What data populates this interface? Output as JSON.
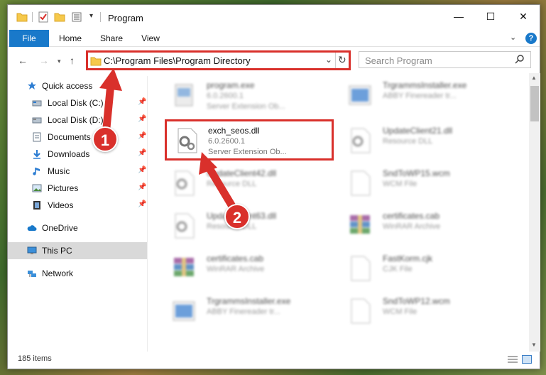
{
  "window": {
    "title": "Program",
    "controls": {
      "minimize": "—",
      "maximize": "☐",
      "close": "✕"
    }
  },
  "ribbon": {
    "tabs": [
      "File",
      "Home",
      "Share",
      "View"
    ],
    "collapse_icon": "chevron-down-icon",
    "help_label": "?"
  },
  "address_bar": {
    "path": "C:\\Program Files\\Program Directory",
    "refresh_icon": "refresh-icon"
  },
  "search": {
    "placeholder": "Search Program"
  },
  "sidebar": {
    "items": [
      {
        "label": "Quick access",
        "icon": "star-icon",
        "pinned": false
      },
      {
        "label": "Local Disk (C:)",
        "icon": "drive-icon",
        "pinned": true
      },
      {
        "label": "Local Disk (D:)",
        "icon": "drive-icon",
        "pinned": true
      },
      {
        "label": "Documents",
        "icon": "documents-icon",
        "pinned": true
      },
      {
        "label": "Downloads",
        "icon": "download-icon",
        "pinned": true
      },
      {
        "label": "Music",
        "icon": "music-icon",
        "pinned": true
      },
      {
        "label": "Pictures",
        "icon": "pictures-icon",
        "pinned": true
      },
      {
        "label": "Videos",
        "icon": "videos-icon",
        "pinned": true
      },
      {
        "label": "OneDrive",
        "icon": "cloud-icon",
        "pinned": false
      },
      {
        "label": "This PC",
        "icon": "computer-icon",
        "pinned": false,
        "selected": true
      },
      {
        "label": "Network",
        "icon": "network-icon",
        "pinned": false
      }
    ]
  },
  "files": [
    {
      "name": "program.exe",
      "version": "6.0.2600.1",
      "description": "Server Extension Ob...",
      "icon": "exe-icon",
      "blurred": true
    },
    {
      "name": "TrgrammsInstaller.exe",
      "version": "ABBY Finereader tr...",
      "description": "",
      "icon": "installer-icon",
      "blurred": true
    },
    {
      "name": "exch_seos.dll",
      "version": "6.0.2600.1",
      "description": "Server Extension Ob...",
      "icon": "dll-gear-icon",
      "blurred": false
    },
    {
      "name": "UpdateClient21.dll",
      "version": "Resource DLL",
      "description": "",
      "icon": "dll-gear-icon",
      "blurred": true
    },
    {
      "name": "UpdateClient42.dll",
      "version": "Resource DLL",
      "description": "",
      "icon": "dll-gear-icon",
      "blurred": true
    },
    {
      "name": "SndToWP15.wcm",
      "version": "WCM File",
      "description": "",
      "icon": "file-icon",
      "blurred": true
    },
    {
      "name": "UpdateClient63.dll",
      "version": "Resource DLL",
      "description": "",
      "icon": "dll-gear-icon",
      "blurred": true
    },
    {
      "name": "certificates.cab",
      "version": "WinRAR Archive",
      "description": "",
      "icon": "archive-icon",
      "blurred": true
    },
    {
      "name": "certificates.cab",
      "version": "WinRAR Archive",
      "description": "",
      "icon": "archive-icon",
      "blurred": true
    },
    {
      "name": "FastKorm.cjk",
      "version": "CJK File",
      "description": "",
      "icon": "file-icon",
      "blurred": true
    },
    {
      "name": "TrgrammsInstaller.exe",
      "version": "ABBY Finereader tr...",
      "description": "",
      "icon": "installer-icon",
      "blurred": true
    },
    {
      "name": "SndToWP12.wcm",
      "version": "WCM File",
      "description": "",
      "icon": "file-icon",
      "blurred": true
    }
  ],
  "status": {
    "item_count": "185 items"
  },
  "annotations": {
    "step1": "1",
    "step2": "2"
  },
  "colors": {
    "accent": "#1979ca",
    "highlight": "#d9302b",
    "selected_bg": "#d9d9d9"
  }
}
